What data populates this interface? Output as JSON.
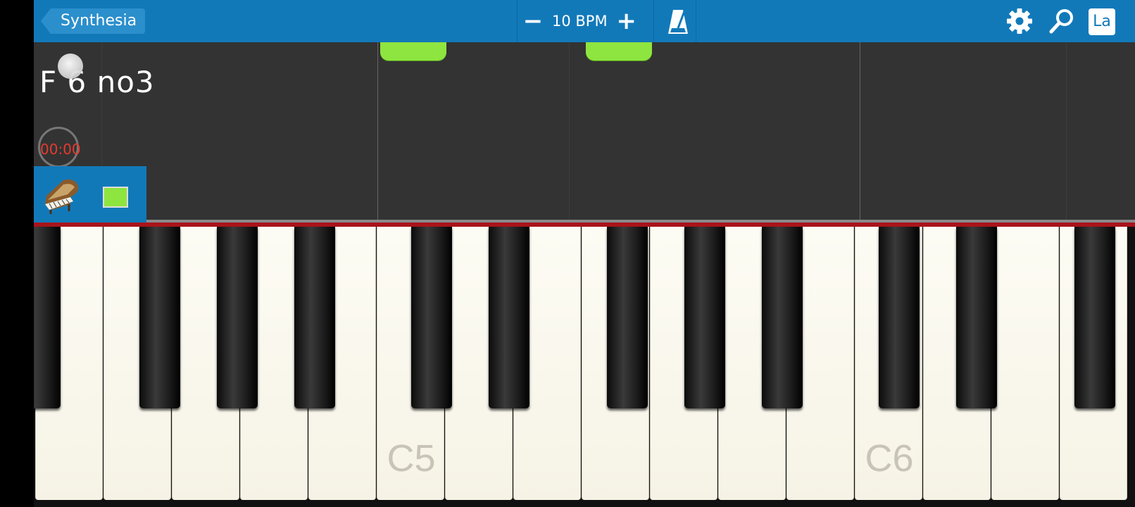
{
  "topbar": {
    "back_label": "Synthesia",
    "bpm_minus": "−",
    "bpm_label": "10 BPM",
    "bpm_plus": "+",
    "lang_label": "La"
  },
  "notes": {
    "chord_label": "F 6 no3",
    "timer": "00:00"
  },
  "keyboard": {
    "labels": {
      "c5": "C5",
      "c6": "C6"
    }
  },
  "colors": {
    "toolbar": "#1279b9",
    "note": "#8ee53f",
    "timer_text": "#e53b2f",
    "hit_line": "#a8141b"
  }
}
